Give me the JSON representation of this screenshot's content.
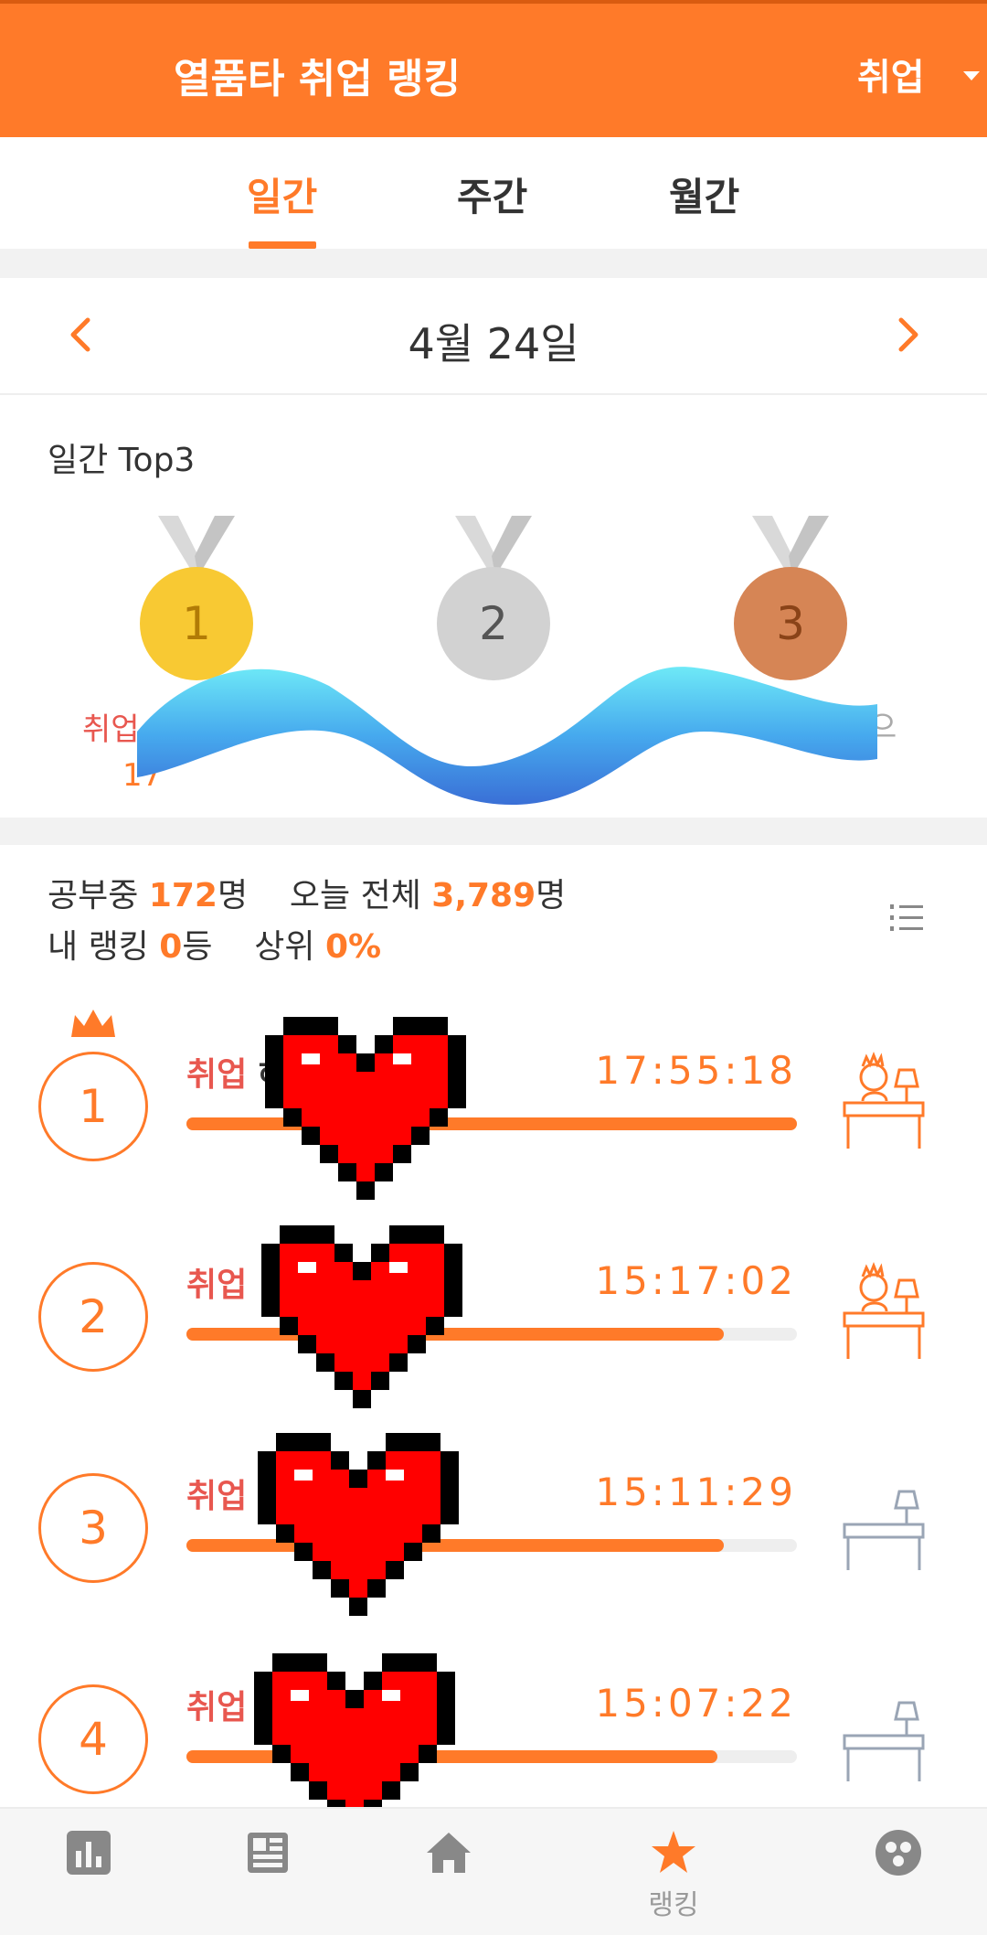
{
  "header": {
    "title": "열품타 취업 랭킹",
    "category": "취업"
  },
  "tabs": [
    {
      "label": "일간",
      "active": true
    },
    {
      "label": "주간",
      "active": false
    },
    {
      "label": "월간",
      "active": false
    }
  ],
  "date_nav": {
    "date": "4월  24일"
  },
  "top3": {
    "title": "일간 Top3",
    "medals": [
      "1",
      "2",
      "3"
    ],
    "first_category": "취업",
    "first_time_fragment": "17",
    "third_name_fragment": "으"
  },
  "stats": {
    "studying_label": "공부중",
    "studying_count": "172",
    "studying_unit": "명",
    "total_label": "오늘 전체",
    "total_count": "3,789",
    "total_unit": "명",
    "my_rank_label": "내 랭킹",
    "my_rank": "0",
    "my_rank_unit": "등",
    "top_label": "상위",
    "top_percent": "0%"
  },
  "rankings": [
    {
      "rank": "1",
      "category": "취업",
      "name_fragment": "해",
      "time": "17:55:18",
      "progress": 1.0,
      "status": "studying"
    },
    {
      "rank": "2",
      "category": "취업",
      "name_fragment": "",
      "time": "15:17:02",
      "progress": 0.88,
      "status": "studying"
    },
    {
      "rank": "3",
      "category": "취업",
      "name_fragment": "",
      "time": "15:11:29",
      "progress": 0.88,
      "status": "idle"
    },
    {
      "rank": "4",
      "category": "취업",
      "name_fragment": "",
      "time": "15:07:22",
      "progress": 0.87,
      "status": "idle"
    }
  ],
  "bottom_nav": {
    "items": [
      {
        "icon": "stats-icon",
        "label": ""
      },
      {
        "icon": "planner-icon",
        "label": ""
      },
      {
        "icon": "home-icon",
        "label": ""
      },
      {
        "icon": "star-icon",
        "label": "랭킹"
      },
      {
        "icon": "group-icon",
        "label": ""
      }
    ]
  },
  "colors": {
    "accent": "#ff7a29",
    "category_red": "#e8574f",
    "gold": "#f8c933",
    "silver": "#d2d2d2",
    "bronze": "#d68555"
  }
}
